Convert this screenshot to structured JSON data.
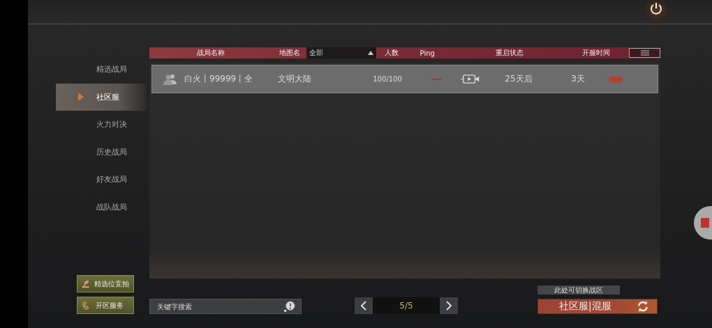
{
  "sidebar": {
    "items": [
      {
        "label": "精选战局",
        "selected": false
      },
      {
        "label": "社区服",
        "selected": true
      },
      {
        "label": "火力对决",
        "selected": false
      },
      {
        "label": "历史战局",
        "selected": false
      },
      {
        "label": "好友战局",
        "selected": false
      },
      {
        "label": "战队战局",
        "selected": false
      }
    ],
    "buttons": [
      {
        "label": "精选位竞拍",
        "kind": "gavel"
      },
      {
        "label": "开区服务",
        "kind": "phone"
      }
    ]
  },
  "table": {
    "columns": [
      {
        "label": "战局名称"
      },
      {
        "label": "地图名"
      },
      {
        "label": "全部",
        "kind": "filter"
      },
      {
        "label": "人数"
      },
      {
        "label": "Ping"
      },
      {
        "label": "重启状态"
      },
      {
        "label": "开服时间"
      }
    ],
    "rows": [
      {
        "name": "白火丨99999丨全",
        "map": "文明大陆",
        "players": "100/100",
        "restart": "25天后",
        "uptime": "3天",
        "selected": true
      }
    ]
  },
  "search": {
    "placeholder": "关键字搜索"
  },
  "pager": {
    "page": "5/5"
  },
  "switch": {
    "tooltip": "此处可切换战区",
    "label": "社区服|混服"
  }
}
